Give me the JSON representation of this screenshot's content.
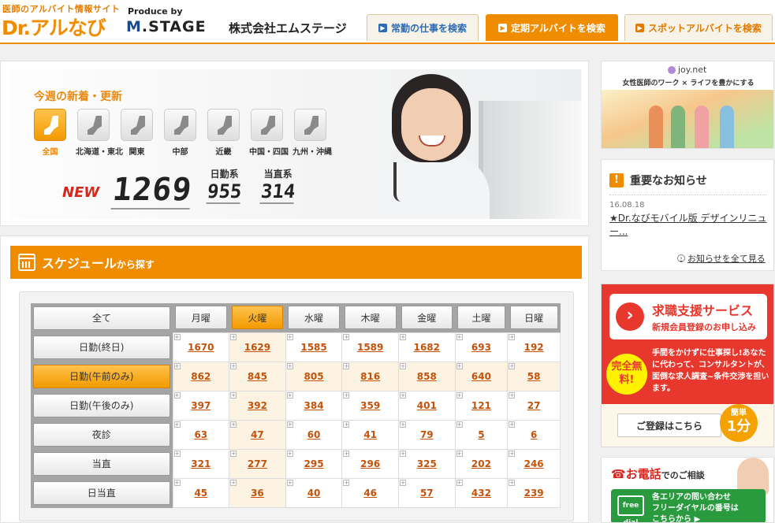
{
  "header": {
    "logo_sub": "医師のアルバイト情報サイト",
    "logo_main_prefix": "Dr.",
    "logo_main_suffix": "アルなび",
    "produce_by": "Produce by",
    "stage_logo_prefix": "M",
    "stage_logo_suffix": ".STAGE",
    "company_name": "株式会社エムステージ",
    "tabs": [
      {
        "label": "常勤の仕事を検索",
        "active": false
      },
      {
        "label": "定期アルバイトを検索",
        "active": true
      },
      {
        "label": "スポットアルバイトを検索",
        "active": false
      }
    ]
  },
  "hero": {
    "title": "今週の新着・更新",
    "regions": [
      {
        "label": "全国",
        "active": true
      },
      {
        "label": "北海道・東北",
        "active": false
      },
      {
        "label": "関東",
        "active": false
      },
      {
        "label": "中部",
        "active": false
      },
      {
        "label": "近畿",
        "active": false
      },
      {
        "label": "中国・四国",
        "active": false
      },
      {
        "label": "九州・沖縄",
        "active": false
      }
    ],
    "new_label": "NEW",
    "total": "1269",
    "day_label": "日勤系",
    "day_count": "955",
    "duty_label": "当直系",
    "duty_count": "314"
  },
  "schedule": {
    "title_main": "スケジュール",
    "title_suffix": "から探す",
    "all_label": "全て",
    "days": [
      "月曜",
      "火曜",
      "水曜",
      "木曜",
      "金曜",
      "土曜",
      "日曜"
    ],
    "active_day_index": 1,
    "active_row_index": 1,
    "rows": [
      {
        "label": "日勤(終日)",
        "values": [
          "1670",
          "1629",
          "1585",
          "1589",
          "1682",
          "693",
          "192"
        ]
      },
      {
        "label": "日勤(午前のみ)",
        "values": [
          "862",
          "845",
          "805",
          "816",
          "858",
          "640",
          "58"
        ]
      },
      {
        "label": "日勤(午後のみ)",
        "values": [
          "397",
          "392",
          "384",
          "359",
          "401",
          "121",
          "27"
        ]
      },
      {
        "label": "夜診",
        "values": [
          "63",
          "47",
          "60",
          "41",
          "79",
          "5",
          "6"
        ]
      },
      {
        "label": "当直",
        "values": [
          "321",
          "277",
          "295",
          "296",
          "325",
          "202",
          "246"
        ]
      },
      {
        "label": "日当直",
        "values": [
          "45",
          "36",
          "40",
          "46",
          "57",
          "432",
          "239"
        ]
      }
    ]
  },
  "sidebar": {
    "joy": {
      "logo": "joy.net",
      "tagline": "女性医師のワーク × ライフを豊かにする"
    },
    "news": {
      "heading": "重要なお知らせ",
      "date": "16.08.18",
      "item": "★Dr.なびモバイル版 デザインリニュー...",
      "more": "お知らせを全て見る"
    },
    "support": {
      "title": "求職支援サービス",
      "subtitle": "新規会員登録のお申し込み",
      "badge": "完全無料!",
      "description": "手間をかけずに仕事探し!あなたに代わって、コンサルタントが、面倒な求人調査~条件交渉を担います。",
      "register_button": "ご登録はこちら",
      "easy_label": "簡単",
      "easy_value": "1分"
    },
    "phone": {
      "heading_main": "お電話",
      "heading_suffix": "でのご相談",
      "freedial_icon": "free dial",
      "text_line1": "各エリアの問い合わせ",
      "text_line2": "フリーダイヤルの番号は",
      "text_line3": "こちらから ▶"
    }
  },
  "colors": {
    "accent": "#f08c00",
    "link": "#c4520a",
    "support_red": "#e8372d"
  }
}
